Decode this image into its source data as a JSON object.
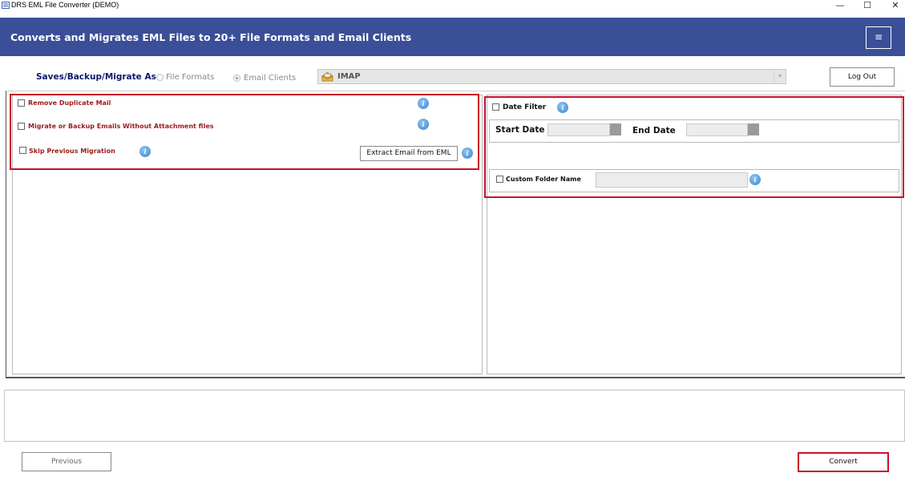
{
  "window": {
    "title": "DRS EML File Converter (DEMO)",
    "minimize": "—",
    "maximize": "☐",
    "close": "✕"
  },
  "banner": {
    "title": "Converts and Migrates EML Files to 20+ File Formats and Email Clients",
    "menu_icon": "≡"
  },
  "saves": {
    "label": "Saves/Backup/Migrate As :",
    "options": [
      {
        "label": "File Formats",
        "selected": false
      },
      {
        "label": "Email Clients",
        "selected": true
      }
    ],
    "selected_client": "IMAP",
    "dropdown_icon": "mailbox-icon"
  },
  "toolbar": {
    "logout_label": "Log Out"
  },
  "left_options": {
    "remove_duplicate": "Remove Duplicate Mail",
    "without_attachment": "Migrate or Backup Emails Without Attachment files",
    "skip_previous": "Skip Previous Migration",
    "extract_button": "Extract Email from EML",
    "info_glyph": "i"
  },
  "right_options": {
    "date_filter": "Date Filter",
    "start_date_label": "Start Date",
    "end_date_label": "End Date",
    "start_date_value": "",
    "end_date_value": "",
    "custom_folder": "Custom Folder Name",
    "custom_folder_value": ""
  },
  "footer": {
    "previous_label": "Previous",
    "convert_label": "Convert"
  },
  "colors": {
    "banner": "#3a4f97",
    "highlight": "#c8102e",
    "option_text": "#9b1c1c",
    "label_navy": "#0b1a6b"
  }
}
